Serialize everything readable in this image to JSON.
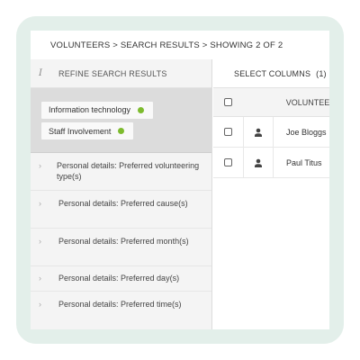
{
  "breadcrumb": {
    "text": "VOLUNTEERS > SEARCH RESULTS > SHOWING 2 OF 2"
  },
  "sidebar": {
    "info_icon": "i",
    "header": "REFINE SEARCH RESULTS",
    "active_filters": [
      {
        "label": "Information technology",
        "status_color": "#7dbb2e"
      },
      {
        "label": "Staff Involvement",
        "status_color": "#7dbb2e"
      }
    ],
    "facets": [
      {
        "label": "Personal details: Preferred volunteering type(s)"
      },
      {
        "label": "Personal details: Preferred cause(s)"
      },
      {
        "label": "Personal details: Preferred month(s)"
      },
      {
        "label": "Personal details: Preferred day(s)"
      },
      {
        "label": "Personal details: Preferred time(s)"
      }
    ]
  },
  "results": {
    "select_columns_label": "SELECT COLUMNS",
    "selected_count": "(1)",
    "column_header": "VOLUNTEE",
    "rows": [
      {
        "name": "Joe Bloggs",
        "icon": "person-icon"
      },
      {
        "name": "Paul Titus",
        "icon": "person-icon"
      }
    ]
  },
  "colors": {
    "frame": "#e3efea",
    "filter_dot": "#7dbb2e",
    "filter_area": "#dcdcdc"
  }
}
